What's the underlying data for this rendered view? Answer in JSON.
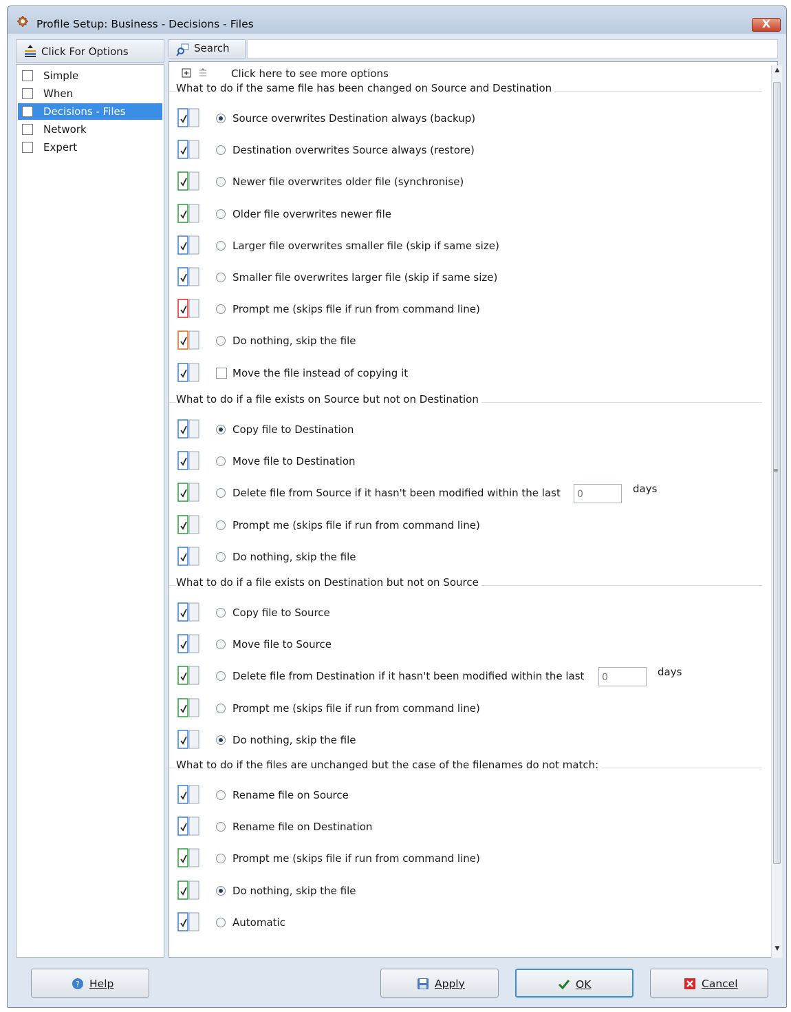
{
  "window": {
    "title": "Profile Setup: Business - Decisions - Files",
    "close_label": "X"
  },
  "left": {
    "options_label": "Click For Options",
    "nav": [
      {
        "label": "Simple",
        "icon": "checklist-icon"
      },
      {
        "label": "When",
        "icon": "calendar-icon"
      },
      {
        "label": "Decisions - Files",
        "icon": "grid-icon",
        "selected": true
      },
      {
        "label": "Network",
        "icon": "network-icon"
      },
      {
        "label": "Expert",
        "icon": "table-icon"
      }
    ]
  },
  "search": {
    "label": "Search",
    "value": ""
  },
  "more_options": "Click here to see more options",
  "groups": [
    {
      "title": "What to do if the same file has been changed on Source and Destination",
      "options": [
        {
          "label": "Source overwrites Destination always (backup)",
          "selected": true
        },
        {
          "label": "Destination overwrites Source always (restore)"
        },
        {
          "label": "Newer file overwrites older file (synchronise)"
        },
        {
          "label": "Older file overwrites newer file"
        },
        {
          "label": "Larger file overwrites smaller file (skip if same size)"
        },
        {
          "label": "Smaller file overwrites larger file (skip if same size)"
        },
        {
          "label": "Prompt me (skips file if run from command line)"
        },
        {
          "label": "Do nothing, skip the file"
        },
        {
          "label": "Move the file instead of copying it",
          "checkbox": true
        }
      ]
    },
    {
      "title": "What to do if a file exists on Source but not on Destination",
      "options": [
        {
          "label": "Copy file to Destination",
          "selected": true
        },
        {
          "label": "Move file to Destination"
        },
        {
          "label": "Delete file from Source if it hasn't been modified within the last",
          "days_value": "0",
          "days_label": "days"
        },
        {
          "label": "Prompt me  (skips file if run from command line)"
        },
        {
          "label": "Do nothing, skip the file"
        }
      ]
    },
    {
      "title": "What to do if a file exists on Destination but not on Source",
      "options": [
        {
          "label": "Copy file to Source"
        },
        {
          "label": "Move file to Source"
        },
        {
          "label": "Delete file from Destination if it hasn't been modified within the last",
          "days_value": "0",
          "days_label": "days"
        },
        {
          "label": "Prompt me  (skips file if run from command line)"
        },
        {
          "label": "Do nothing, skip the file",
          "selected": true
        }
      ]
    },
    {
      "title": "What to do if the files are unchanged but the case of the filenames do not match:",
      "options": [
        {
          "label": "Rename file on Source"
        },
        {
          "label": "Rename file on Destination"
        },
        {
          "label": "Prompt me  (skips file if run from command line)"
        },
        {
          "label": "Do nothing, skip the file",
          "selected": true
        },
        {
          "label": "Automatic"
        }
      ]
    }
  ],
  "buttons": {
    "help": "Help",
    "apply": "Apply",
    "ok": "OK",
    "cancel": "Cancel"
  }
}
